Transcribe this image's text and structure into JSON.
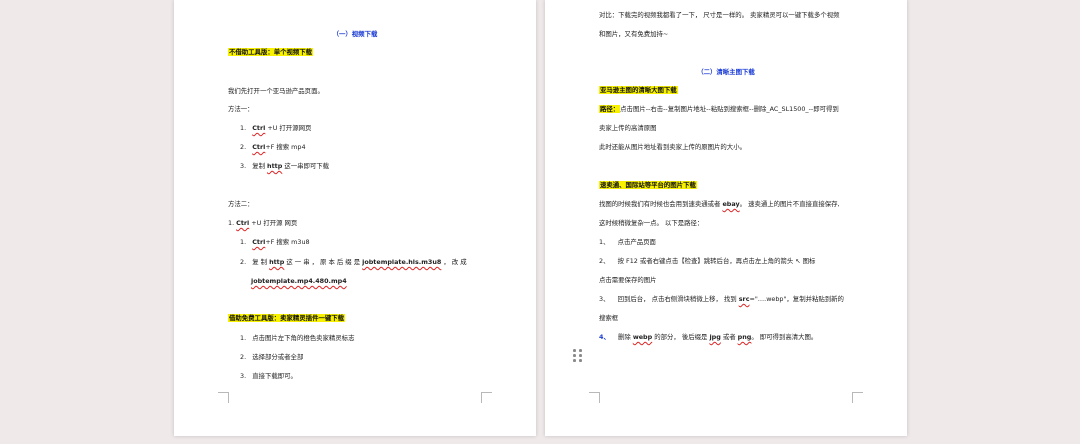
{
  "left_page": {
    "section_title": "（一）视频下载",
    "heading1": "不借助工具版：单个视频下载",
    "intro": "我们先打开一个亚马逊产品页面。",
    "method1_label": "方法一：",
    "method1_steps": [
      {
        "num": "1.",
        "pre": "",
        "key": "Ctrl",
        "post": " +U 打开源网页"
      },
      {
        "num": "2.",
        "pre": "",
        "key": "Ctrl",
        "post": "+F 搜索 mp4"
      },
      {
        "num": "3.",
        "pre": "复制 ",
        "key": "http",
        "post": " 这一串即可下载"
      }
    ],
    "method2_label": "方法二：",
    "method2_first": {
      "num": "1. ",
      "key": "Ctrl",
      "post": " +U 打开源 网页"
    },
    "method2_steps": [
      {
        "num": "1.",
        "key": "Ctrl",
        "post": "+F 搜索 m3u8"
      }
    ],
    "method2_step2": {
      "num": "2.",
      "part1": "复 制 ",
      "key1": "http",
      "part2": " 这 一 串 ， 原 本 后 缀 是 ",
      "key2": "jobtemplate.hls.m3u8",
      "part3": " ， 改 成",
      "key3": "jobtemplate.mp4.480.mp4"
    },
    "heading2": "借助免费工具版：卖家精灵插件一键下载",
    "plugin_steps": [
      {
        "num": "1.",
        "text": "点击图片左下角的橙色卖家精灵标志"
      },
      {
        "num": "2.",
        "text": "选择部分或者全部"
      },
      {
        "num": "3.",
        "text": "直接下载即可。"
      }
    ]
  },
  "right_page": {
    "line1": "对比：下载完的视频我都看了一下， 尺寸是一样的。 卖家精灵可以一键下载多个视频",
    "line2": "和图片，又有免费加持~",
    "section_title": "（二）清晰主图下载",
    "heading1": "亚马逊主图的清晰大图下载",
    "path_label": "路径：",
    "path_text1": "点击图片--右击--复制图片地址--粘贴到搜索框--删除_AC_SL1500_--即可得到",
    "path_text2": "卖家上传的高清原图",
    "path_note": "此时还能从图片地址看到卖家上传的原图片的大小。",
    "heading2": "速卖通、国际站等平台的图片下载",
    "text1_pre": "找图的时候我们有时候也会用到速卖通或者 ",
    "text1_key": "ebay",
    "text1_post": "。 速卖通上的图片不直接直接保存,",
    "text2": "这时候稍微复杂一点。 以下是路径：",
    "steps": {
      "s1_num": "1、",
      "s1_text": "点击产品页面",
      "s2_num": "2、",
      "s2_text": "按 F12 或者右键点击【检查】跳转后台，再点击左上角的箭头 ↖ 图标",
      "s2_cont": "点击需要保存的图片",
      "s3_num": "3、",
      "s3_pre": "回到后台， 点击右侧滑块稍微上移， 找到 ",
      "s3_key": "src",
      "s3_post": "=\"….webp\"，复制并粘贴到新的",
      "s3_cont": "搜索框",
      "s4_num": "4、",
      "s4_pre": "删除 ",
      "s4_key1": "webp",
      "s4_mid1": " 的部分， 後后缀是 ",
      "s4_key2": "jpg",
      "s4_mid2": " 或者 ",
      "s4_key3": "png",
      "s4_post": "。 即可得到高清大图。"
    }
  },
  "icons": {
    "drag_handle": "drag-handle-icon"
  }
}
